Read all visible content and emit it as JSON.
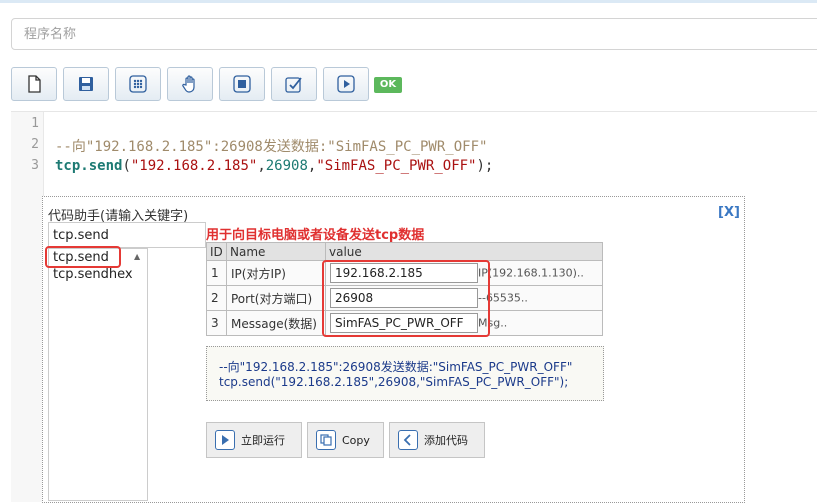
{
  "program_name": {
    "placeholder": "程序名称"
  },
  "toolbar": {
    "buttons": [
      "new-file-icon",
      "save-icon",
      "grid-icon",
      "hand-icon",
      "stop-icon",
      "check-icon",
      "play-icon"
    ],
    "ok_badge": "OK"
  },
  "editor": {
    "line_numbers": [
      "1",
      "2",
      "3"
    ],
    "line2_comment": "--向\"192.168.2.185\":26908发送数据:\"SimFAS_PC_PWR_OFF\"",
    "line3": {
      "obj": "tcp.send",
      "open": "(",
      "arg1": "\"192.168.2.185\"",
      "comma1": ",",
      "arg2": "26908",
      "comma2": ",",
      "arg3": "\"SimFAS_PC_PWR_OFF\"",
      "close": ");"
    }
  },
  "helper": {
    "title": "代码助手(请输入关键字)",
    "close": "[X]",
    "keyword": "tcp.send",
    "description": "用于向目标电脑或者设备发送tcp数据",
    "list": [
      "tcp.send",
      "tcp.sendhex"
    ],
    "table": {
      "headers": [
        "ID",
        "Name",
        "value"
      ],
      "rows": [
        {
          "id": "1",
          "name": "IP(对方IP)",
          "value": "192.168.2.185",
          "hint": "IP(192.168.1.130).."
        },
        {
          "id": "2",
          "name": "Port(对方端口)",
          "value": "26908",
          "hint": "--65535.."
        },
        {
          "id": "3",
          "name": "Message(数据)",
          "value": "SimFAS_PC_PWR_OFF",
          "hint": "Msg.."
        }
      ]
    },
    "preview": {
      "line1": "--向\"192.168.2.185\":26908发送数据:\"SimFAS_PC_PWR_OFF\"",
      "line2": "tcp.send(\"192.168.2.185\",26908,\"SimFAS_PC_PWR_OFF\");"
    },
    "buttons": {
      "run": "立即运行",
      "copy": "Copy",
      "add": "添加代码"
    }
  }
}
